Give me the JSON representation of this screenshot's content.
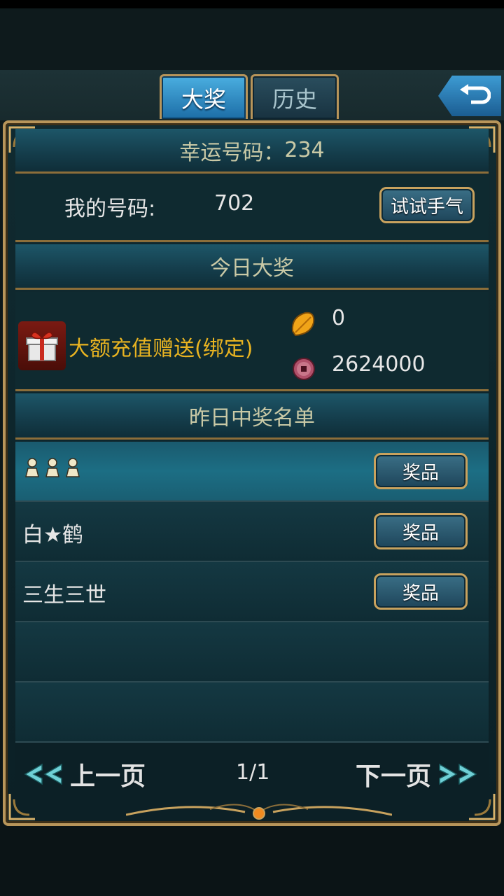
{
  "tabs": [
    {
      "label": "大奖",
      "active": true
    },
    {
      "label": "历史",
      "active": false
    }
  ],
  "back_icon": "return-arrow-icon",
  "lucky": {
    "label": "幸运号码：",
    "value": "234"
  },
  "mine": {
    "label": "我的号码:",
    "value": "702",
    "button": "试试手气"
  },
  "today": {
    "header": "今日大奖",
    "prize_icon": "gift-box-icon",
    "prize_name": "大额充值赠送(绑定)",
    "gold_icon": "gold-leaf-icon",
    "gold_value": "0",
    "coin_icon": "copper-coin-icon",
    "coin_value": "2624000"
  },
  "yesterday": {
    "header": "昨日中奖名单",
    "winners": [
      {
        "name": "",
        "name_icon": "three-figure-icons",
        "button": "奖品"
      },
      {
        "name": "白★鹤",
        "button": "奖品"
      },
      {
        "name": "三生三世",
        "button": "奖品"
      }
    ]
  },
  "pager": {
    "prev": "上一页",
    "page": "1/1",
    "next": "下一页"
  },
  "colors": {
    "gold_border": "#b8955a",
    "prize_text": "#e8b321",
    "active_tab": "#2d8cc8"
  }
}
